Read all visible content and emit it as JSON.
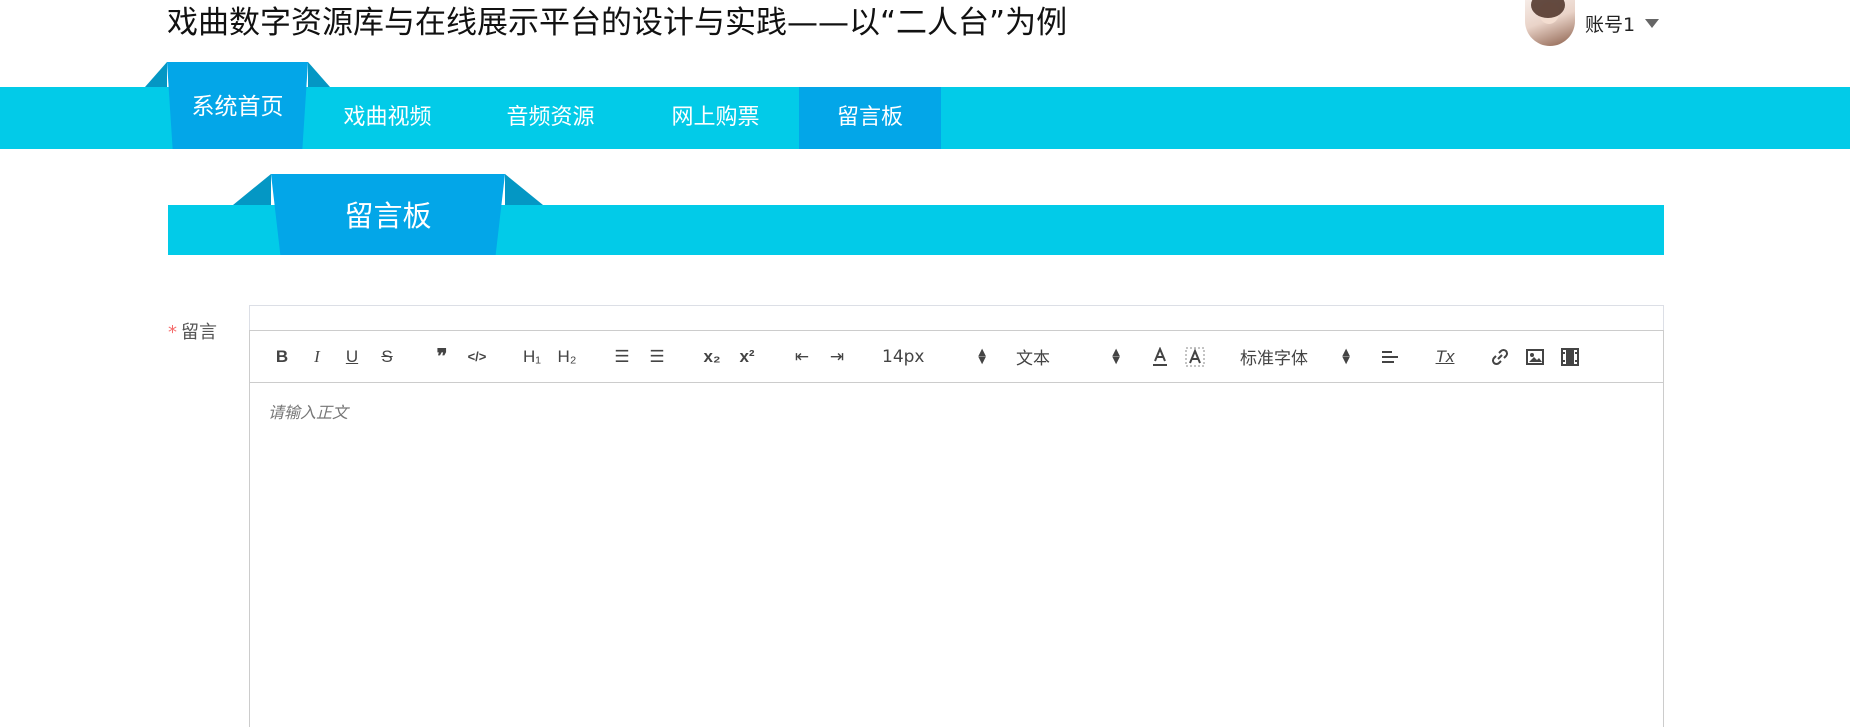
{
  "site": {
    "title": "戏曲数字资源库与在线展示平台的设计与实践——以“二人台”为例"
  },
  "user": {
    "name": "账号1"
  },
  "nav": {
    "items": [
      {
        "label": "系统首页"
      },
      {
        "label": "戏曲视频"
      },
      {
        "label": "音频资源"
      },
      {
        "label": "网上购票"
      },
      {
        "label": "留言板"
      }
    ],
    "active": "留言板"
  },
  "section": {
    "title": "留言板"
  },
  "form": {
    "required_mark": "*",
    "label": "留言",
    "placeholder": "请输入正文"
  },
  "toolbar": {
    "bold": "B",
    "italic": "I",
    "underline": "U",
    "strike": "S",
    "blockquote": "❞",
    "code": "</>",
    "h1": "H₁",
    "h2": "H₂",
    "ordered_list": "☰",
    "bullet_list": "☰",
    "subscript": "x₂",
    "superscript": "x²",
    "outdent": "⇤",
    "indent": "⇥",
    "size_value": "14px",
    "header_value": "文本",
    "font_value": "标准字体",
    "clean": "Tx"
  },
  "colors": {
    "nav_bg": "#02cbe8",
    "nav_active": "#03a6e8",
    "ear_dark": "#0497c4"
  }
}
